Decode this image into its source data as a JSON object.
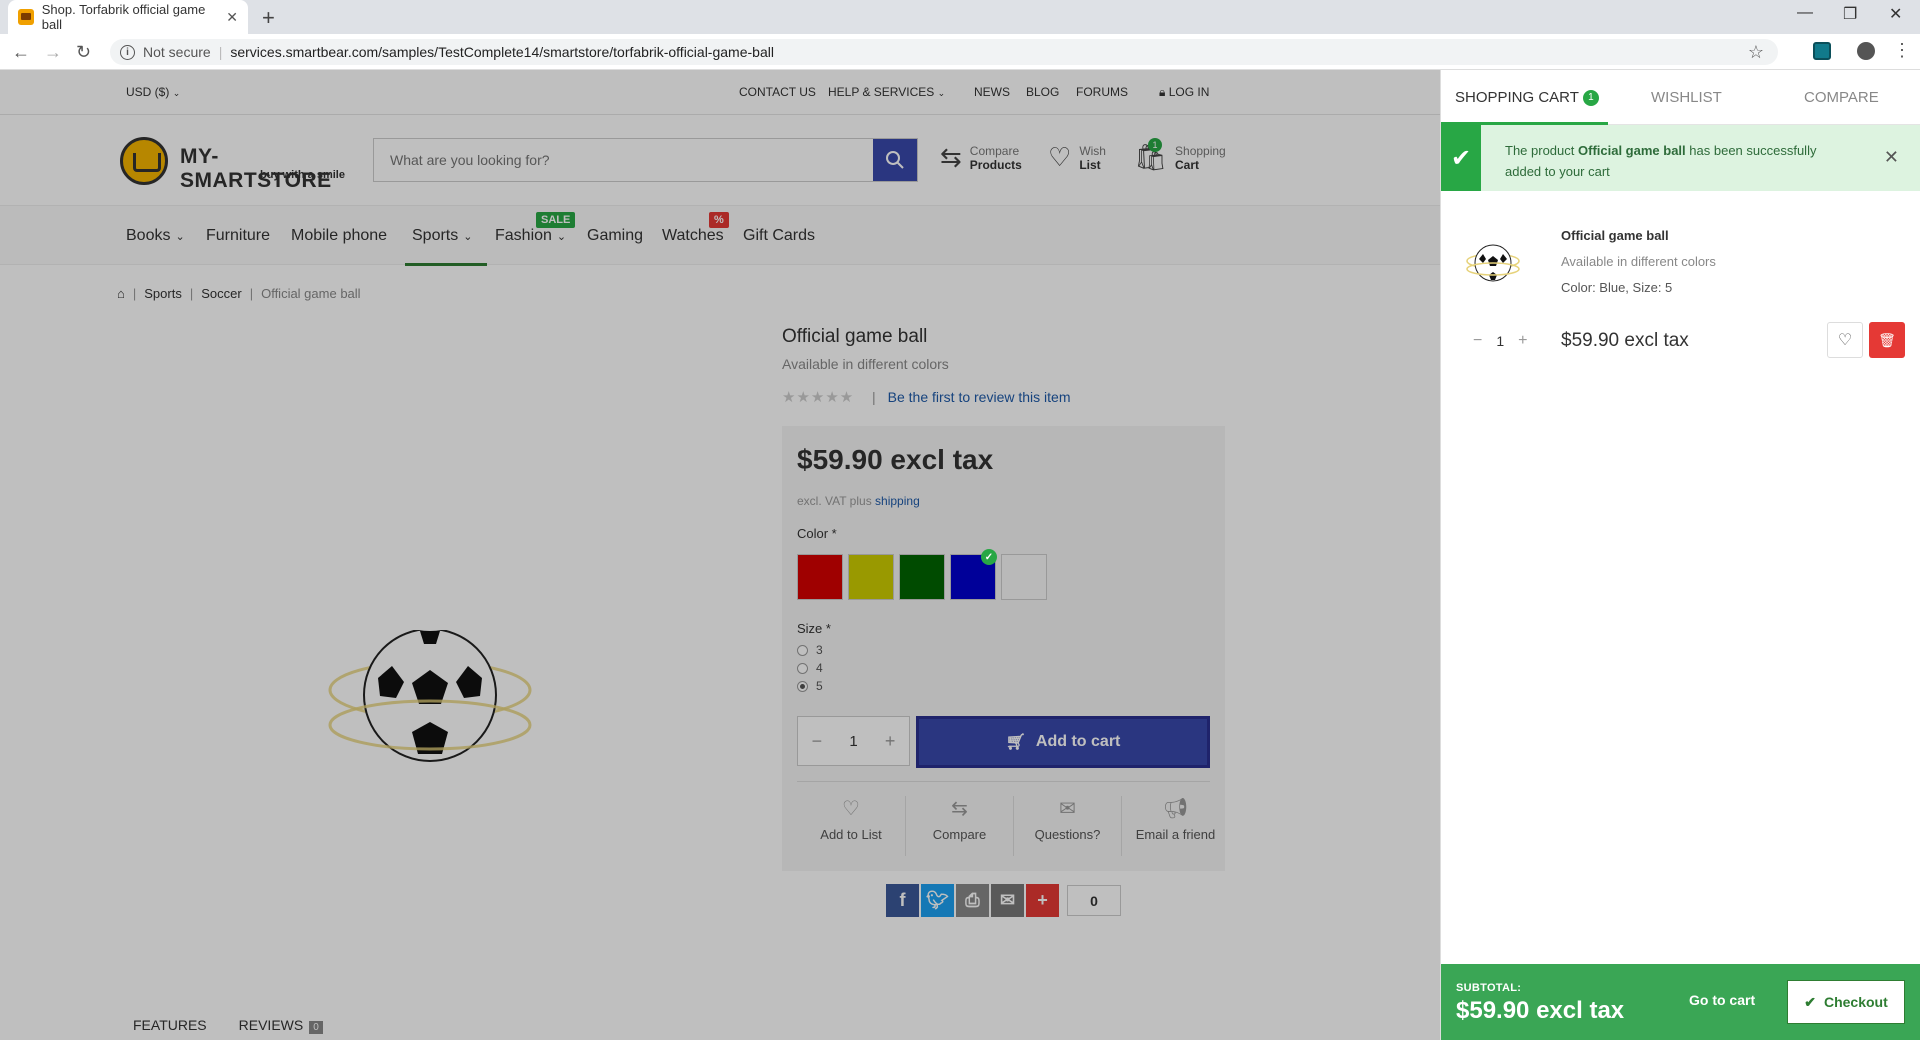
{
  "browser": {
    "tab_title": "Shop. Torfabrik official game ball",
    "security_label": "Not secure",
    "url": "services.smartbear.com/samples/TestComplete14/smartstore/torfabrik-official-game-ball"
  },
  "topbar": {
    "currency": "USD ($)",
    "links": [
      "CONTACT US",
      "HELP & SERVICES",
      "NEWS",
      "BLOG",
      "FORUMS",
      "LOG IN"
    ]
  },
  "header": {
    "logo_name": "MY-SMARTSTORE",
    "logo_tagline": "buy with a smile",
    "search_placeholder": "What are you looking for?",
    "compare": {
      "line1": "Compare",
      "line2": "Products"
    },
    "wish": {
      "line1": "Wish",
      "line2": "List"
    },
    "cart": {
      "line1": "Shopping",
      "line2": "Cart",
      "count": "1"
    }
  },
  "nav": {
    "items": [
      "Books",
      "Furniture",
      "Mobile phone",
      "Sports",
      "Fashion",
      "Gaming",
      "Watches",
      "Gift Cards"
    ],
    "badge_sale": "SALE",
    "badge_pct": "%"
  },
  "breadcrumb": {
    "items": [
      "Sports",
      "Soccer"
    ],
    "current": "Official game ball"
  },
  "product": {
    "title": "Official game ball",
    "subtitle": "Available in different colors",
    "review_link": "Be the first to review this item",
    "price": "$59.90 excl tax",
    "vat_text": "excl. VAT plus",
    "vat_link": "shipping",
    "color_label": "Color *",
    "colors": [
      "#d50000",
      "#cccc00",
      "#006400",
      "#0000cd",
      "#f7f7f7"
    ],
    "selected_color": "Blue",
    "size_label": "Size *",
    "sizes": [
      "3",
      "4",
      "5"
    ],
    "selected_size": "5",
    "quantity": "1",
    "add_to_cart": "Add to cart",
    "actions": [
      "Add to List",
      "Compare",
      "Questions?",
      "Email a friend"
    ],
    "share_count": "0"
  },
  "tabs": {
    "features": "FEATURES",
    "reviews": "REVIEWS",
    "reviews_count": "0"
  },
  "drawer": {
    "tabs": [
      "SHOPPING CART",
      "WISHLIST",
      "COMPARE"
    ],
    "cart_count": "1",
    "notice_pre": "The product",
    "notice_product": "Official game ball",
    "notice_post": "has been successfully added to your cart",
    "item": {
      "name": "Official game ball",
      "sub": "Available in different colors",
      "attrs": "Color: Blue, Size: 5",
      "qty": "1",
      "price": "$59.90 excl tax"
    },
    "subtotal_label": "SUBTOTAL:",
    "subtotal": "$59.90 excl tax",
    "go_to_cart": "Go to cart",
    "checkout": "Checkout"
  }
}
